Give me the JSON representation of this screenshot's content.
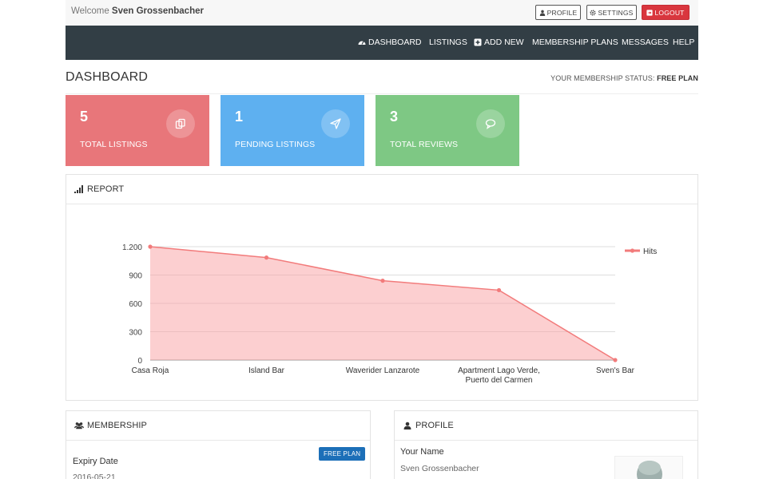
{
  "topbar": {
    "welcome_prefix": "Welcome",
    "user_name": "Sven Grossenbacher",
    "profile_label": "PROFILE",
    "settings_label": "SETTINGS",
    "logout_label": "LOGOUT"
  },
  "nav": {
    "items": [
      {
        "label": "DASHBOARD",
        "icon": "dashboard-icon"
      },
      {
        "label": "LISTINGS"
      },
      {
        "label": "ADD NEW",
        "icon": "plus-square-icon"
      },
      {
        "label": "MEMBERSHIP PLANS"
      },
      {
        "label": "MESSAGES"
      },
      {
        "label": "HELP"
      }
    ]
  },
  "page": {
    "title": "DASHBOARD",
    "membership_status_label": "YOUR MEMBERSHIP STATUS:",
    "membership_status_value": "FREE PLAN"
  },
  "stats": [
    {
      "value": "5",
      "label": "TOTAL LISTINGS",
      "icon": "copy-icon",
      "color": "#e8767a"
    },
    {
      "value": "1",
      "label": "PENDING LISTINGS",
      "icon": "paper-plane-icon",
      "color": "#5eb0f0"
    },
    {
      "value": "3",
      "label": "TOTAL REVIEWS",
      "icon": "comment-icon",
      "color": "#7ec884"
    }
  ],
  "report": {
    "title": "REPORT",
    "icon": "signal-bars-icon"
  },
  "chart_data": {
    "type": "area",
    "categories": [
      "Casa Roja",
      "Island Bar",
      "Waverider Lanzarote",
      "Apartment Lago Verde, Puerto del Carmen",
      "Sven's Bar"
    ],
    "series": [
      {
        "name": "Hits",
        "values": [
          1200,
          1085,
          840,
          740,
          0
        ],
        "color": "#f27b7b"
      }
    ],
    "yticks": [
      "0",
      "300",
      "600",
      "900",
      "1.200"
    ],
    "ylim": [
      0,
      1200
    ],
    "grid": true,
    "legend": "right"
  },
  "membership": {
    "title": "MEMBERSHIP",
    "badge": "FREE PLAN",
    "expiry_label": "Expiry Date",
    "expiry_value": "2016-05-21"
  },
  "profile": {
    "title": "PROFILE",
    "name_label": "Your Name",
    "name_value": "Sven Grossenbacher"
  },
  "colors": {
    "navbar": "#323e45",
    "logout": "#d9363e",
    "badge": "#1c6fb8"
  }
}
